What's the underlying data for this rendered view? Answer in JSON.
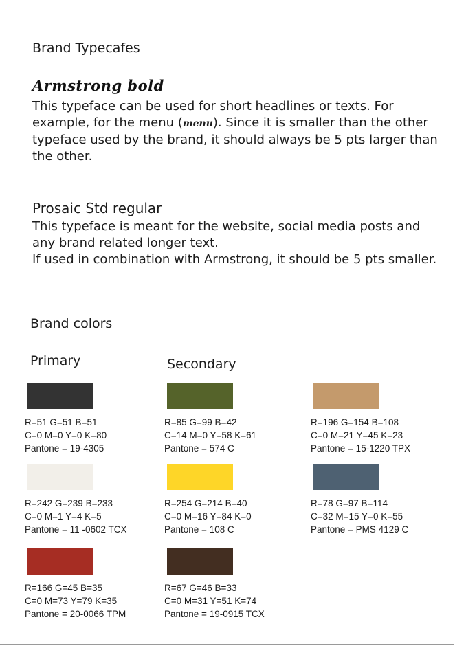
{
  "heading": "Brand Typecafes",
  "armstrong": {
    "title": "Armstrong bold",
    "text_before": "This typeface can be used for short headlines or texts. For example, for the menu (",
    "menu_word": "menu",
    "text_after": "). Since it is smaller than the other typeface used by the brand, it should always be 5 pts larger than the other."
  },
  "prosaic": {
    "title": "Prosaic Std regular",
    "text": "This typeface is meant for the website, social media posts and any brand related longer text.",
    "text2": "If used in combination with Armstrong, it should be 5 pts smaller."
  },
  "colors_heading": "Brand colors",
  "primary_label": "Primary",
  "secondary_label": "Secondary",
  "swatches": [
    {
      "color": "#333333",
      "rgb": "R=51 G=51 B=51",
      "cmyk": "C=0 M=0 Y=0 K=80",
      "pantone": "Pantone  = 19-4305"
    },
    {
      "color": "#55632a",
      "rgb": "R=85 G=99 B=42",
      "cmyk": "C=14 M=0 Y=58 K=61",
      "pantone": "Pantone = 574 C"
    },
    {
      "color": "#c49a6c",
      "rgb": "R=196 G=154 B=108",
      "cmyk": "C=0 M=21 Y=45 K=23",
      "pantone": "Pantone = 15-1220 TPX"
    },
    {
      "color": "#f2efe9",
      "rgb": "R=242 G=239 B=233",
      "cmyk": "C=0 M=1 Y=4 K=5",
      "pantone": "Pantone = 11 -0602 TCX"
    },
    {
      "color": "#fed628",
      "rgb": "R=254 G=214 B=40",
      "cmyk": "C=0 M=16 Y=84 K=0",
      "pantone": "Pantone = 108 C"
    },
    {
      "color": "#4e6172",
      "rgb": "R=78 G=97 B=114",
      "cmyk": "C=32 M=15 Y=0 K=55",
      "pantone": "Pantone = PMS 4129 C"
    },
    {
      "color": "#a62d23",
      "rgb": "R=166 G=45 B=35",
      "cmyk": "C=0 M=73 Y=79 K=35",
      "pantone": "Pantone = 20-0066 TPM"
    },
    {
      "color": "#432e21",
      "rgb": "R=67 G=46 B=33",
      "cmyk": "C=0 M=31 Y=51 K=74",
      "pantone": "Pantone = 19-0915 TCX"
    }
  ]
}
